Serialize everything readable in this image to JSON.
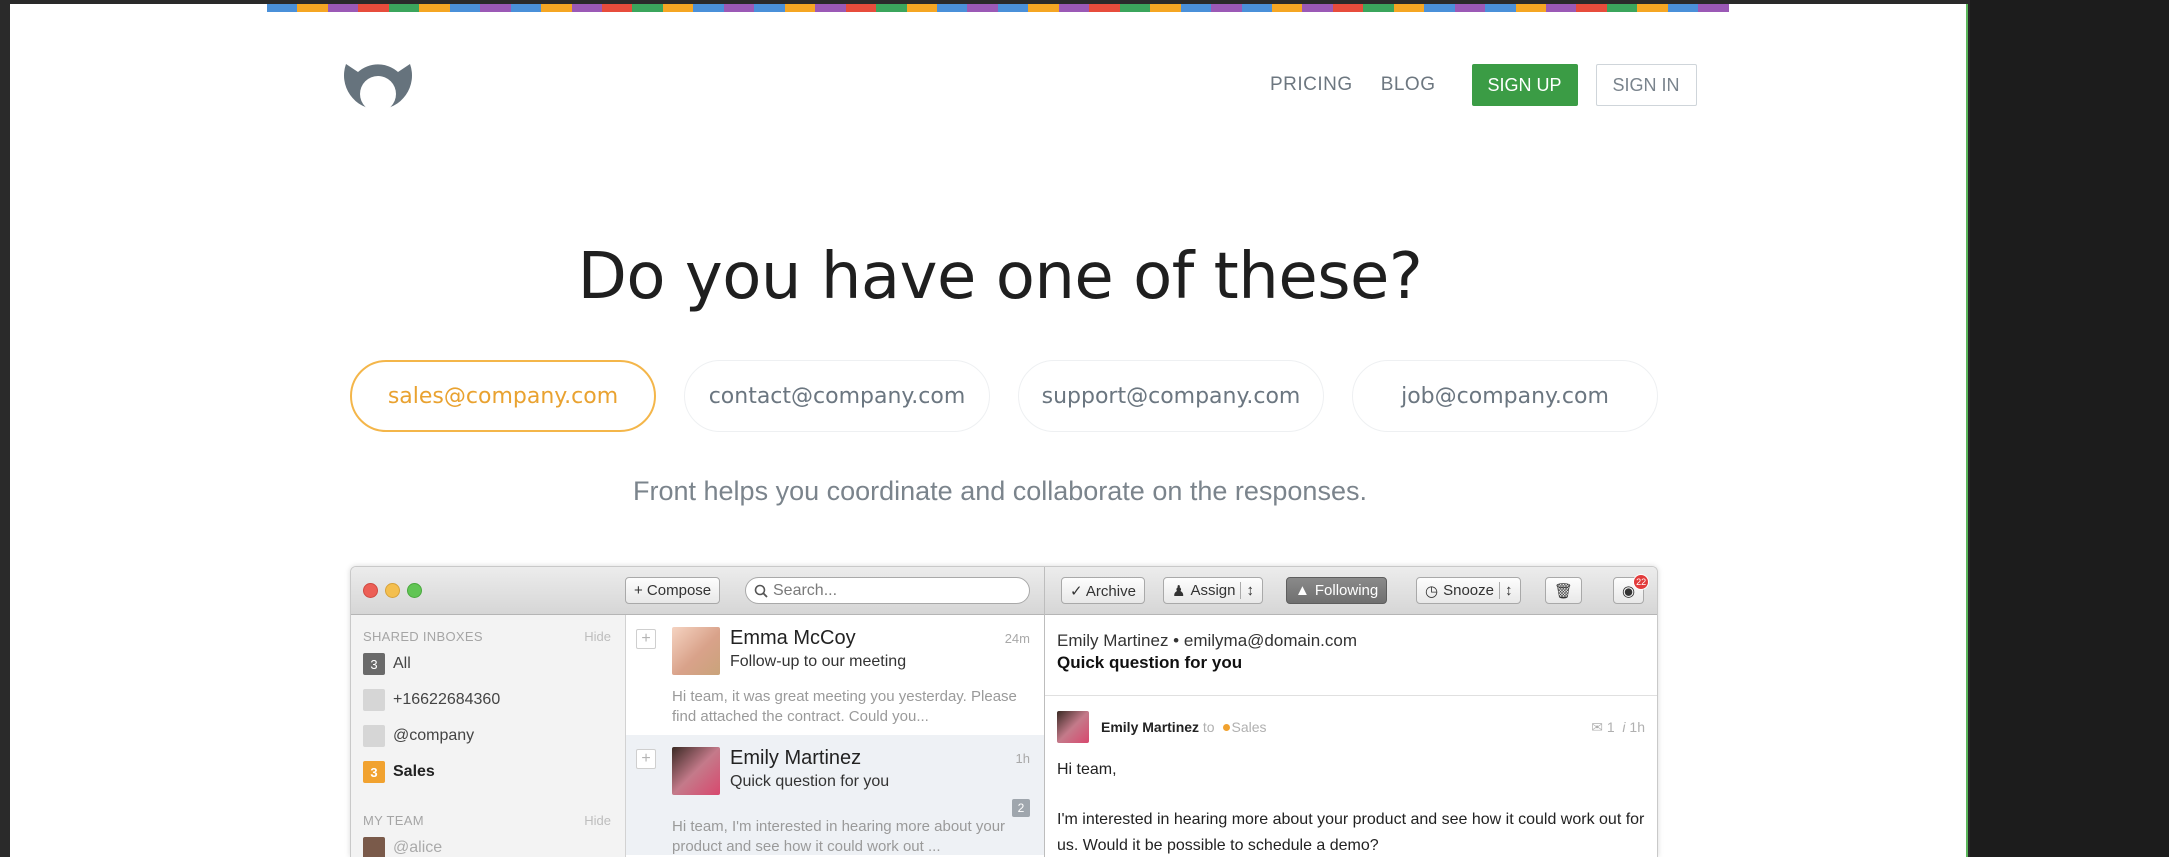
{
  "nav": {
    "links": [
      "PRICING",
      "BLOG"
    ],
    "signup_label": "SIGN UP",
    "signin_label": "SIGN IN"
  },
  "hero": {
    "headline": "Do you have one of these?",
    "emails": [
      "sales@company.com",
      "contact@company.com",
      "support@company.com",
      "job@company.com"
    ],
    "active_email_index": 0,
    "subtext": "Front helps you coordinate and collaborate on the responses."
  },
  "app": {
    "toolbar": {
      "compose": "+ Compose",
      "search_placeholder": "Search...",
      "archive": "✓ Archive",
      "assign": "Assign",
      "following": "Following",
      "snooze": "Snooze",
      "notification_count": "22"
    },
    "sidebar": {
      "shared_heading": "SHARED INBOXES",
      "hide_label": "Hide",
      "items": [
        {
          "badge": "3",
          "label": "All"
        },
        {
          "badge": "",
          "label": "+16622684360"
        },
        {
          "badge": "",
          "label": "@company"
        },
        {
          "badge": "3",
          "label": "Sales"
        }
      ],
      "team_heading": "MY TEAM",
      "team_items": [
        {
          "label": "@alice"
        }
      ]
    },
    "conversations": [
      {
        "name": "Emma McCoy",
        "subject": "Follow-up to our meeting",
        "time": "24m",
        "preview": "Hi team, it was great meeting you yesterday. Please find attached the contract. Could you...",
        "count": ""
      },
      {
        "name": "Emily Martinez",
        "subject": "Quick question for you",
        "time": "1h",
        "preview": "Hi team, I'm interested in hearing more about your product and see how it could work out ...",
        "count": "2"
      }
    ],
    "detail": {
      "from": "Emily Martinez • emilyma@domain.com",
      "subject": "Quick question for you",
      "sender": "Emily Martinez",
      "to_word": "to",
      "inbox": "Sales",
      "comment_count": "1",
      "time": "1h",
      "greeting": "Hi team,",
      "body": "I'm interested in hearing more about your product and see how it could work out for us. Would it be possible to schedule a demo?"
    }
  },
  "colors": {
    "stripe": [
      "#4a90d9",
      "#f5a623",
      "#9b59b6",
      "#e74c3c",
      "#3ba55c",
      "#f5a623",
      "#4a90d9",
      "#9b59b6"
    ],
    "accent_green": "#3b9c45",
    "accent_orange": "#f4b64a"
  }
}
